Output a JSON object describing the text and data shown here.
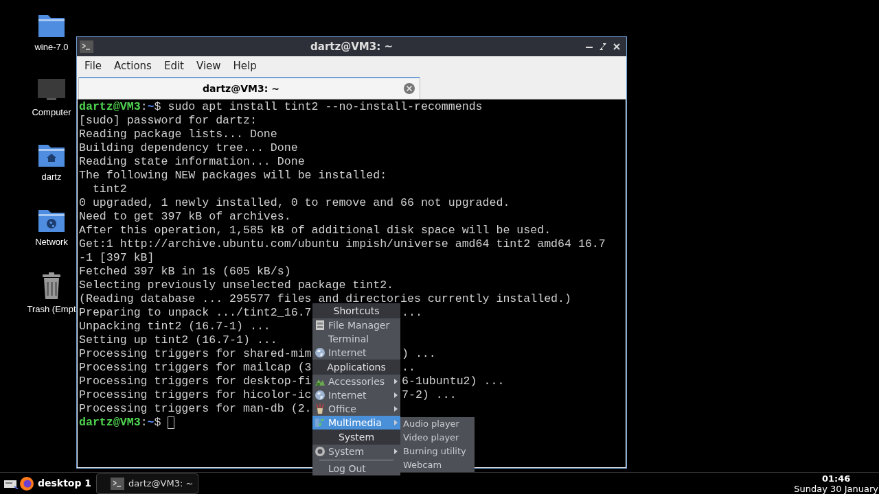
{
  "desktop_icons": [
    {
      "label": "wine-7.0",
      "kind": "folder"
    },
    {
      "label": "Computer",
      "kind": "monitor"
    },
    {
      "label": "dartz",
      "kind": "home"
    },
    {
      "label": "Network",
      "kind": "network"
    },
    {
      "label": "Trash (Empt",
      "kind": "trash"
    }
  ],
  "window": {
    "title": "dartz@VM3: ~",
    "menu": [
      "File",
      "Actions",
      "Edit",
      "View",
      "Help"
    ],
    "tabs": [
      {
        "label": "dartz@VM3: ~",
        "selected": true
      }
    ],
    "terminal_lines": [
      {
        "kind": "prompt",
        "user": "dartz@VM3",
        "sep": ":",
        "path": "~",
        "sigil": "$",
        "command": "sudo apt install tint2 --no-install-recommends"
      },
      {
        "kind": "output",
        "text": "[sudo] password for dartz:"
      },
      {
        "kind": "output",
        "text": "Reading package lists... Done"
      },
      {
        "kind": "output",
        "text": "Building dependency tree... Done"
      },
      {
        "kind": "output",
        "text": "Reading state information... Done"
      },
      {
        "kind": "output",
        "text": "The following NEW packages will be installed:"
      },
      {
        "kind": "output",
        "text": "  tint2"
      },
      {
        "kind": "output",
        "text": "0 upgraded, 1 newly installed, 0 to remove and 66 not upgraded."
      },
      {
        "kind": "output",
        "text": "Need to get 397 kB of archives."
      },
      {
        "kind": "output",
        "text": "After this operation, 1,585 kB of additional disk space will be used."
      },
      {
        "kind": "output",
        "text": "Get:1 http://archive.ubuntu.com/ubuntu impish/universe amd64 tint2 amd64 16.7"
      },
      {
        "kind": "output",
        "text": "-1 [397 kB]"
      },
      {
        "kind": "output",
        "text": "Fetched 397 kB in 1s (605 kB/s)"
      },
      {
        "kind": "output",
        "text": "Selecting previously unselected package tint2."
      },
      {
        "kind": "output",
        "text": "(Reading database ... 295577 files and directories currently installed.)"
      },
      {
        "kind": "output",
        "text": "Preparing to unpack .../tint2_16.7",
        "after": "..."
      },
      {
        "kind": "output",
        "text": "Unpacking tint2 (16.7-1) ..."
      },
      {
        "kind": "output",
        "text": "Setting up tint2 (16.7-1) ..."
      },
      {
        "kind": "output",
        "text": "Processing triggers for shared-mim",
        "after": ") ..."
      },
      {
        "kind": "output",
        "text": "Processing triggers for mailcap (3",
        "after": ".."
      },
      {
        "kind": "output",
        "text": "Processing triggers for desktop-fi",
        "after": "6-1ubuntu2) ..."
      },
      {
        "kind": "output",
        "text": "Processing triggers for hicolor-ic",
        "after": "7-2) ..."
      },
      {
        "kind": "output",
        "text": "Processing triggers for man-db (2."
      },
      {
        "kind": "prompt",
        "user": "dartz@VM3",
        "sep": ":",
        "path": "~",
        "sigil": "$",
        "cursor": true
      }
    ]
  },
  "menu": [
    {
      "kind": "header",
      "label": "Shortcuts"
    },
    {
      "kind": "item",
      "label": "File Manager",
      "submenu": false,
      "selected": false
    },
    {
      "kind": "item",
      "label": "Terminal",
      "submenu": false,
      "selected": false
    },
    {
      "kind": "item",
      "label": "Internet",
      "submenu": false,
      "selected": false
    },
    {
      "kind": "header",
      "label": "Applications"
    },
    {
      "kind": "item",
      "label": "Accessories",
      "submenu": true,
      "selected": false
    },
    {
      "kind": "item",
      "label": "Internet",
      "submenu": true,
      "selected": false
    },
    {
      "kind": "item",
      "label": "Office",
      "submenu": true,
      "selected": false
    },
    {
      "kind": "item",
      "label": "Multimedia",
      "submenu": true,
      "selected": true,
      "open_submenu": [
        "Audio player",
        "Video player",
        "Burning utility",
        "Webcam"
      ]
    },
    {
      "kind": "header",
      "label": "System"
    },
    {
      "kind": "item",
      "label": "System",
      "submenu": true,
      "selected": false
    },
    {
      "kind": "separator"
    },
    {
      "kind": "item",
      "label": "Log Out",
      "submenu": false,
      "selected": false
    }
  ],
  "taskbar": {
    "desktop": "desktop 1",
    "tasks": [
      {
        "label": "dartz@VM3: ~",
        "selected": false
      }
    ],
    "time": "01:46",
    "date": "Sunday 30 January"
  }
}
